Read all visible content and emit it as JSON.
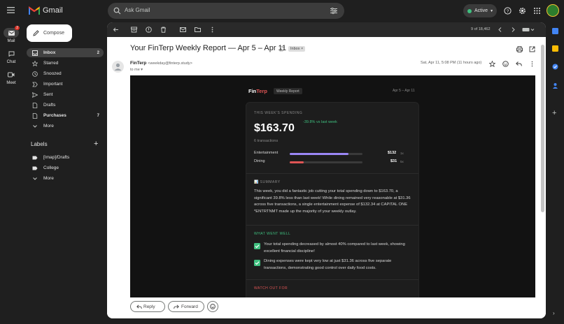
{
  "app": {
    "name": "Gmail"
  },
  "search": {
    "placeholder": "Ask Gmail"
  },
  "status": {
    "label": "Active"
  },
  "rail": {
    "mail": "Mail",
    "chat": "Chat",
    "meet": "Meet",
    "mail_badge": "2"
  },
  "compose": {
    "label": "Compose"
  },
  "nav": [
    {
      "label": "Inbox",
      "count": "2"
    },
    {
      "label": "Starred",
      "count": ""
    },
    {
      "label": "Snoozed",
      "count": ""
    },
    {
      "label": "Important",
      "count": ""
    },
    {
      "label": "Sent",
      "count": ""
    },
    {
      "label": "Drafts",
      "count": ""
    },
    {
      "label": "Purchases",
      "count": "7"
    },
    {
      "label": "More",
      "count": ""
    }
  ],
  "labels": {
    "title": "Labels",
    "items": [
      "[Imap]/Drafts",
      "College",
      "More"
    ]
  },
  "toolbar": {
    "pager": "9 of 18,462"
  },
  "email": {
    "subject": "Your FinTerp Weekly Report — Apr 5 – Apr 11",
    "chip": "Inbox",
    "sender_name": "FinTerp",
    "sender_email": "<weekday@finterp.study>",
    "to": "to me",
    "date": "Sat, Apr 11, 5:08 PM (11 hours ago)"
  },
  "report": {
    "brand_a": "Fin",
    "brand_b": "Terp",
    "tag": "Weekly Report",
    "range": "Apr 5 – Apr 11",
    "spend_label": "THIS WEEK'S SPENDING",
    "amount": "$163.70",
    "change": "-39.8% vs last week",
    "txn": "6 transactions",
    "categories": [
      {
        "name": "Entertainment",
        "amount": "$132",
        "count": "1x",
        "fraction": 0.81,
        "color": "#9b87f5"
      },
      {
        "name": "Dining",
        "amount": "$31",
        "count": "5x",
        "fraction": 0.19,
        "color": "#e05555"
      }
    ],
    "summary_label": "SUMMARY",
    "summary": "This week, you did a fantastic job cutting your total spending down to $163.70, a significant 39.8% less than last week! While dining remained very reasonable at $31.36 across five transactions, a single entertainment expense of $132.34 at CAPITAL ONE *ENTRTNMT made up the majority of your weekly outlay.",
    "well_label": "WHAT WENT WELL",
    "well": [
      "Your total spending decreased by almost 40% compared to last week, showing excellent financial discipline!",
      "Dining expenses were kept very low at just $31.36 across five separate transactions, demonstrating good control over daily food costs."
    ],
    "watch_label": "WATCH OUT FOR"
  },
  "reply": {
    "reply": "Reply",
    "forward": "Forward"
  },
  "colors": {
    "accent_green": "#3fbf7f",
    "accent_red": "#e05555",
    "purple": "#9b87f5"
  }
}
